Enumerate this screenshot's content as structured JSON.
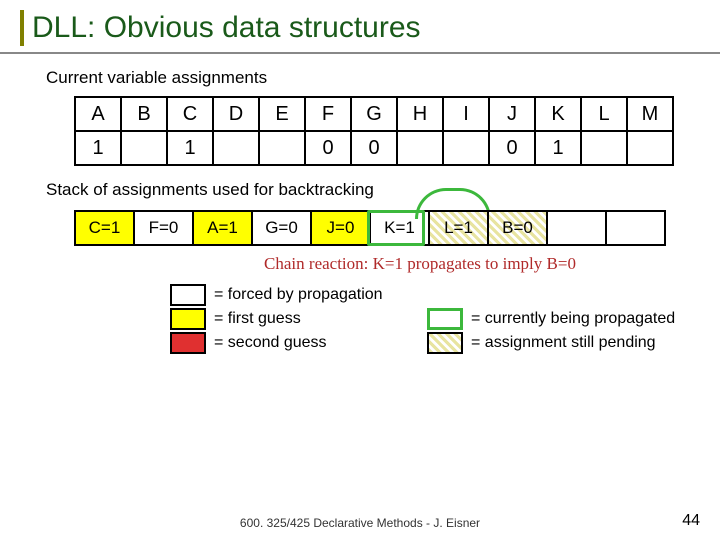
{
  "title": "DLL: Obvious data structures",
  "sub1": "Current variable assignments",
  "vars": {
    "headers": [
      "A",
      "B",
      "C",
      "D",
      "E",
      "F",
      "G",
      "H",
      "I",
      "J",
      "K",
      "L",
      "M"
    ],
    "values": [
      "1",
      "",
      "1",
      "",
      "",
      "0",
      "0",
      "",
      "",
      "0",
      "1",
      "",
      ""
    ]
  },
  "sub2": "Stack of assignments used for backtracking",
  "stack": [
    "C=1",
    "F=0",
    "A=1",
    "G=0",
    "J=0",
    "K=1",
    "L=1",
    "B=0",
    "",
    ""
  ],
  "chain": "Chain reaction: K=1 propagates to imply B=0",
  "legend": {
    "forced": "= forced by propagation",
    "first": "= first guess",
    "second": "= second guess",
    "curr": "= currently being propagated",
    "pending": "= assignment still pending"
  },
  "footer": "600. 325/425 Declarative Methods - J. Eisner",
  "page": "44"
}
